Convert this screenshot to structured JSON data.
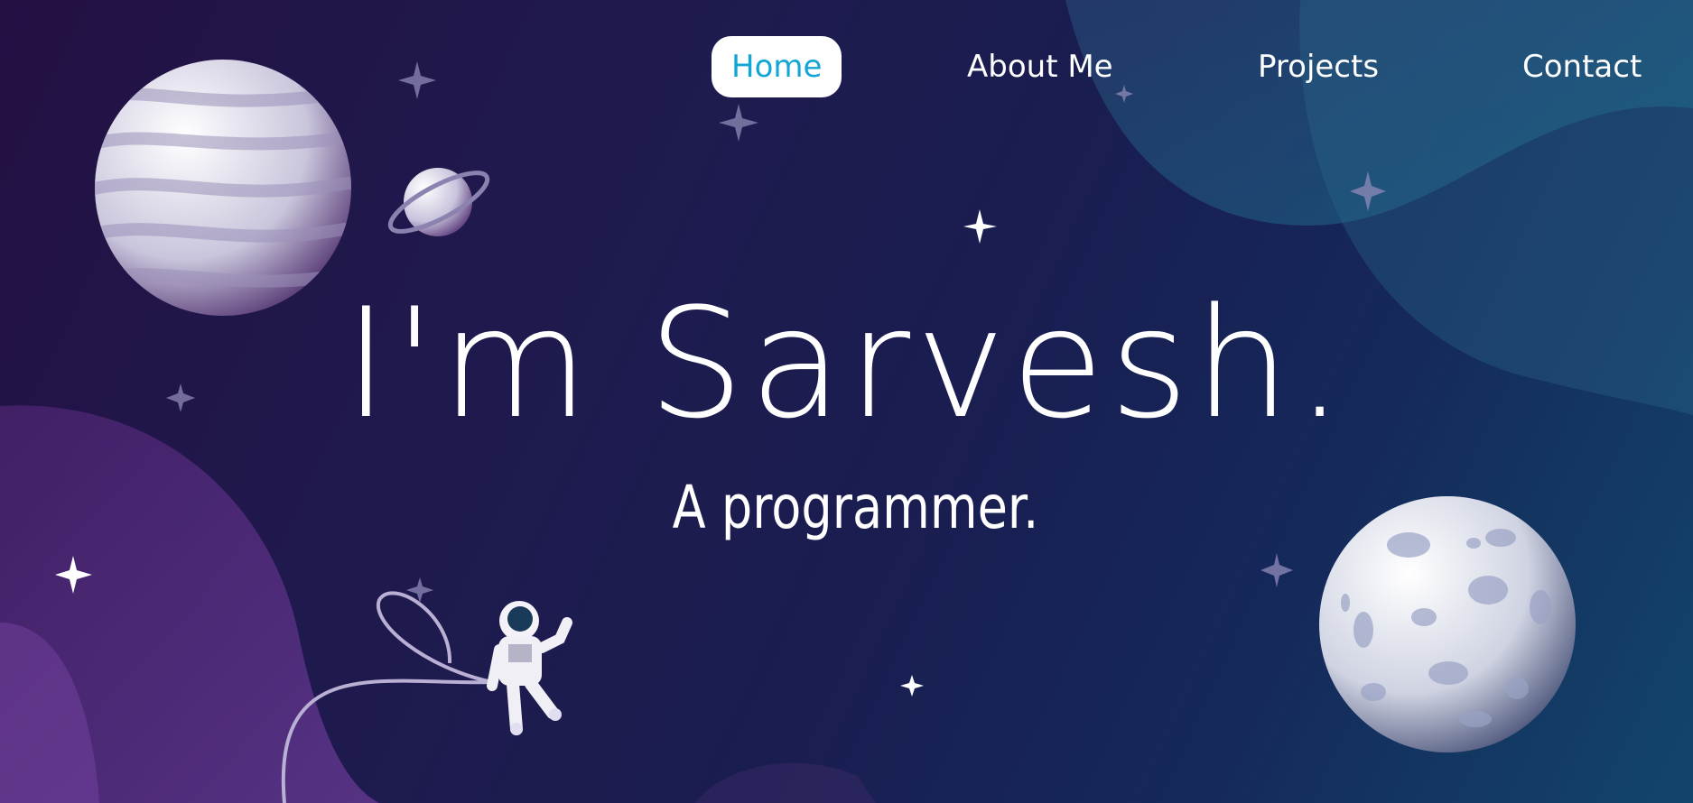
{
  "nav": {
    "items": [
      {
        "label": "Home",
        "active": true
      },
      {
        "label": "About Me",
        "active": false
      },
      {
        "label": "Projects",
        "active": false
      },
      {
        "label": "Contact",
        "active": false
      }
    ]
  },
  "hero": {
    "title": "I'm Sarvesh.",
    "subtitle": "A programmer."
  },
  "colors": {
    "accent": "#12a6d4",
    "text": "#ffffff",
    "bg_start": "#241043",
    "bg_end": "#12456a"
  },
  "decorations": [
    "striped-planet-icon",
    "ringed-planet-icon",
    "astronaut-icon",
    "moon-icon",
    "star-icon"
  ]
}
